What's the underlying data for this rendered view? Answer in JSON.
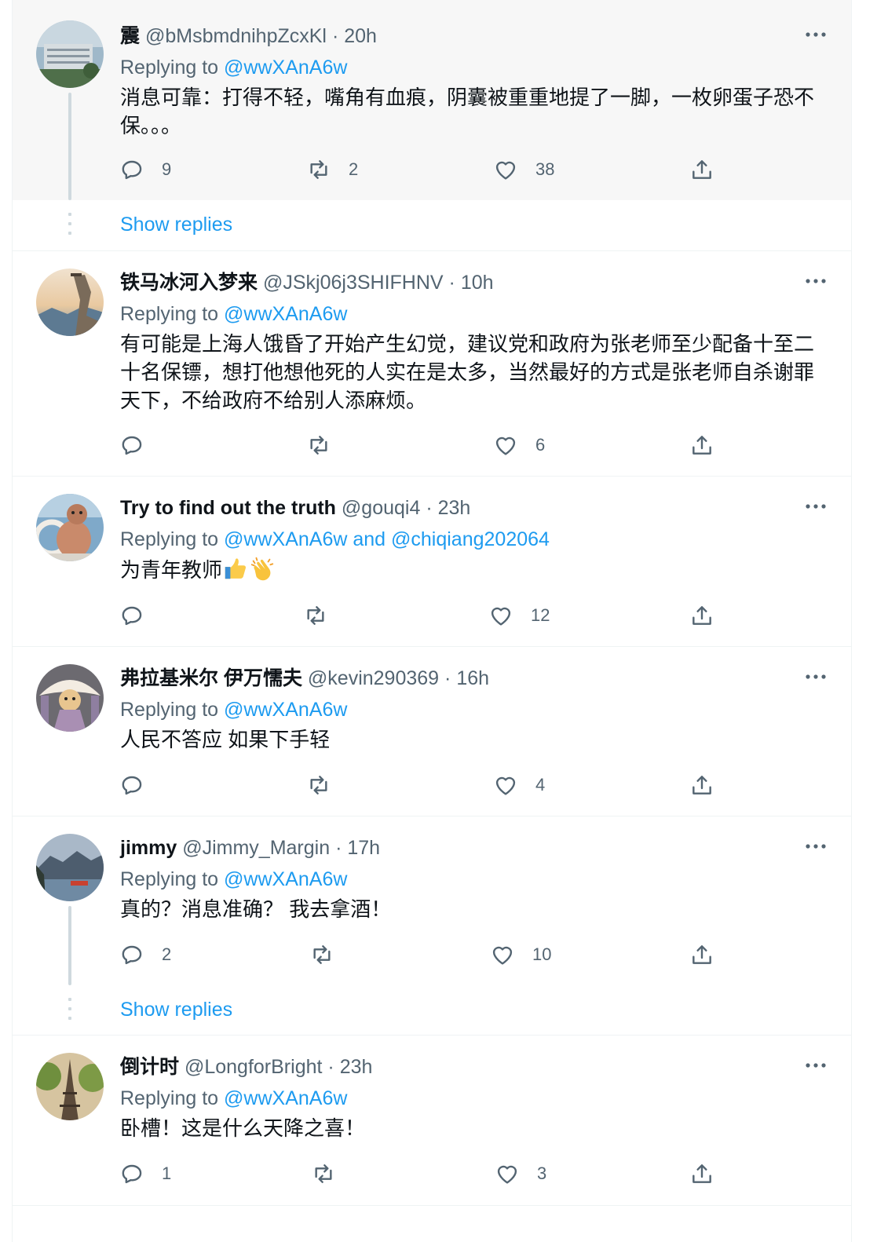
{
  "tweets": [
    {
      "name": "震",
      "handle": "@bMsbmdnihpZcxKl",
      "dot": "·",
      "time": "20h",
      "replying_prefix": "Replying to ",
      "replying_to": "@wwXAnA6w",
      "text": "消息可靠：打得不轻，嘴角有血痕，阴囊被重重地提了一脚，一枚卵蛋子恐不保。。。",
      "replies": "9",
      "retweets": "2",
      "likes": "38",
      "show_replies": "Show replies"
    },
    {
      "name": "铁马冰河入梦来",
      "handle": "@JSkj06j3SHIFHNV",
      "dot": "·",
      "time": "10h",
      "replying_prefix": "Replying to ",
      "replying_to": "@wwXAnA6w",
      "text": "有可能是上海人饿昏了开始产生幻觉，建议党和政府为张老师至少配备十至二十名保镖，想打他想他死的人实在是太多，当然最好的方式是张老师自杀谢罪天下，不给政府不给别人添麻烦。",
      "replies": "",
      "retweets": "",
      "likes": "6"
    },
    {
      "name": "Try to find out the truth",
      "handle": "@gouqi4",
      "dot": "·",
      "time": "23h",
      "replying_prefix": "Replying to ",
      "replying_to": "@wwXAnA6w and @chiqiang202064",
      "text": "为青年教师",
      "replies": "",
      "retweets": "",
      "likes": "12"
    },
    {
      "name": "弗拉基米尔 伊万懦夫",
      "handle": "@kevin290369",
      "dot": "·",
      "time": "16h",
      "replying_prefix": "Replying to ",
      "replying_to": "@wwXAnA6w",
      "text": "人民不答应 如果下手轻",
      "replies": "",
      "retweets": "",
      "likes": "4"
    },
    {
      "name": "jimmy",
      "handle": "@Jimmy_Margin",
      "dot": "·",
      "time": "17h",
      "replying_prefix": "Replying to ",
      "replying_to": "@wwXAnA6w",
      "text": "真的？消息准确？ 我去拿酒！",
      "replies": "2",
      "retweets": "",
      "likes": "10",
      "show_replies": "Show replies"
    },
    {
      "name": "倒计时",
      "handle": "@LongforBright",
      "dot": "·",
      "time": "23h",
      "replying_prefix": "Replying to ",
      "replying_to": "@wwXAnA6w",
      "text": "卧槽！这是什么天降之喜！",
      "replies": "1",
      "retweets": "",
      "likes": "3"
    }
  ],
  "icons": {
    "reply": "reply-icon",
    "retweet": "retweet-icon",
    "like": "heart-icon",
    "share": "share-icon",
    "more": "more-icon",
    "thumbs_up": "thumbs-up-emoji",
    "clap": "clapping-hands-emoji"
  },
  "colors": {
    "link": "#1d9bf0",
    "secondary_text": "#536471",
    "primary_text": "#0f1419",
    "highlight_bg": "#f7f7f7",
    "border": "#eff3f4",
    "thread_line": "#cfd9de"
  }
}
